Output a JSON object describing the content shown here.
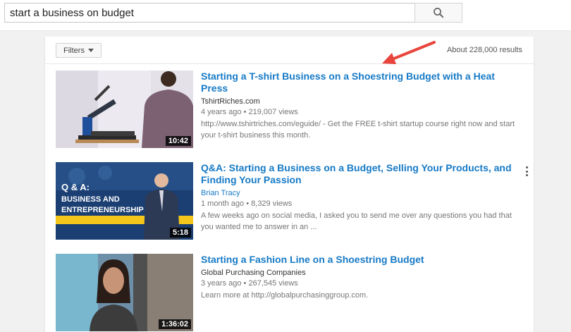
{
  "search": {
    "query": "start a business on budget",
    "button_icon": "search-icon"
  },
  "toolbar": {
    "filters_label": "Filters",
    "result_count": "About 228,000 results"
  },
  "results": [
    {
      "title": "Starting a T-shirt Business on a Shoestring Budget with a Heat Press",
      "channel": "TshirtRiches.com",
      "age": "4 years ago",
      "views": "219,007 views",
      "description": "http://www.tshirtriches.com/eguide/ - Get the FREE t-shirt startup course right now and start your t-shirt business this month.",
      "duration": "10:42"
    },
    {
      "title": "Q&A: Starting a Business on a Budget, Selling Your Products, and Finding Your Passion",
      "channel": "Brian Tracy",
      "age": "1 month ago",
      "views": "8,329 views",
      "description": "A few weeks ago on social media, I asked you to send me over any questions you had that you wanted me to answer in an ...",
      "duration": "5:18",
      "thumb_text": [
        "Q & A:",
        "BUSINESS AND",
        "ENTREPRENEURSHIP"
      ]
    },
    {
      "title": "Starting a Fashion Line on a Shoestring Budget",
      "channel": "Global Purchasing Companies",
      "age": "3 years ago",
      "views": "267,545 views",
      "description": "Learn more at http://globalpurchasinggroup.com.",
      "duration": "1:36:02"
    }
  ],
  "meta_separator": "•",
  "colors": {
    "link_blue": "#167ac6",
    "arrow_red": "#e8453c",
    "thumb2_blue": "#1b3f73",
    "thumb2_yellow": "#f4c51a"
  }
}
